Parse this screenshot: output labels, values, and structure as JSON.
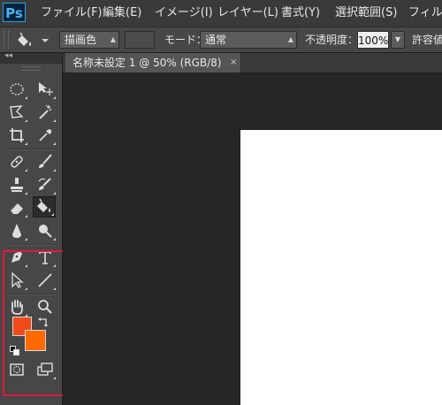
{
  "menu": {
    "logo": "Ps",
    "items": [
      "ファイル(F)",
      "編集(E)",
      "イメージ(I)",
      "レイヤー(L)",
      "書式(Y)",
      "選択範囲(S)",
      "フィルタ"
    ]
  },
  "options": {
    "fill_source": "描画色",
    "mode_label": "モード：",
    "mode_value": "通常",
    "opacity_label": "不透明度：",
    "opacity_value": "100%",
    "tolerance_label": "許容値"
  },
  "panel": {
    "collapse_label": "◂◂"
  },
  "document": {
    "tab_title": "名称未設定 1 @ 50% (RGB/8)",
    "close_glyph": "×"
  },
  "colors": {
    "foreground": "#f14a1a",
    "background": "#ff6a00",
    "highlight": "#e0183e"
  },
  "icons": [
    "marquee-icon",
    "move-icon",
    "lasso-icon",
    "magic-wand-icon",
    "crop-icon",
    "eyedropper-icon",
    "healing-brush-icon",
    "brush-icon",
    "clone-stamp-icon",
    "history-brush-icon",
    "eraser-icon",
    "paint-bucket-icon",
    "blur-icon",
    "dodge-icon",
    "pen-icon",
    "type-icon",
    "path-selection-icon",
    "line-icon",
    "hand-icon",
    "zoom-icon",
    "swap-colors-icon",
    "default-colors-icon",
    "quick-mask-icon",
    "screen-mode-icon"
  ]
}
